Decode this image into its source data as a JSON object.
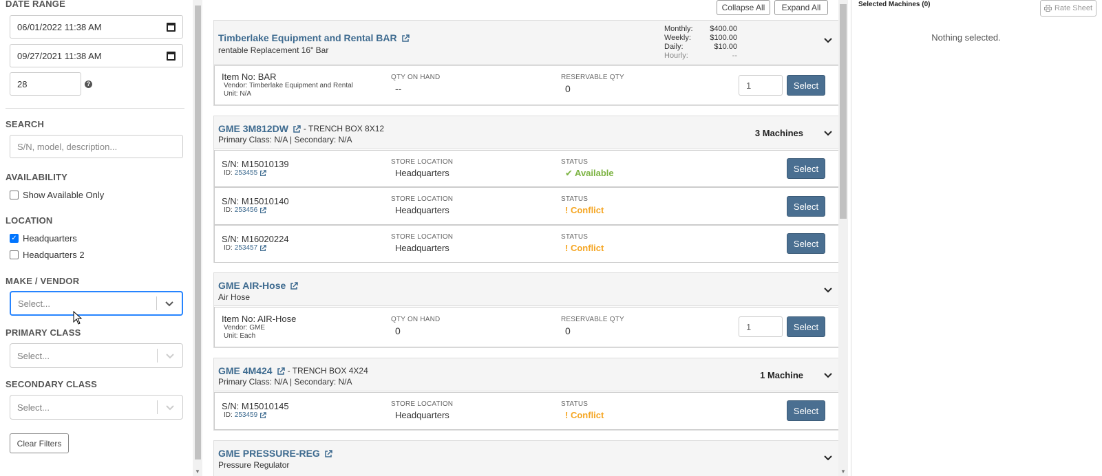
{
  "filters": {
    "date_range_title": "DATE RANGE",
    "start_date": "06/01/2022 11:38  AM",
    "end_date": "09/27/2021 11:38  AM",
    "days": "28",
    "help_glyph": "?",
    "search_title": "SEARCH",
    "search_placeholder": "S/N, model, description...",
    "availability_title": "AVAILABILITY",
    "show_available_label": "Show Available Only",
    "location_title": "LOCATION",
    "locations": [
      {
        "label": "Headquarters",
        "checked": true
      },
      {
        "label": "Headquarters 2",
        "checked": false
      }
    ],
    "make_vendor_title": "MAKE / VENDOR",
    "make_vendor_placeholder": "Select...",
    "primary_class_title": "PRIMARY CLASS",
    "primary_class_placeholder": "Select...",
    "secondary_class_title": "SECONDARY CLASS",
    "secondary_class_placeholder": "Select...",
    "clear_filters_label": "Clear Filters"
  },
  "toolbar": {
    "collapse_all": "Collapse All",
    "expand_all": "Expand All"
  },
  "cards": [
    {
      "title": "Timberlake Equipment and Rental BAR",
      "subtitle": "rentable Replacement 16\" Bar",
      "rates": [
        {
          "label": "Monthly:",
          "value": "$400.00"
        },
        {
          "label": "Weekly:",
          "value": "$100.00"
        },
        {
          "label": "Daily:",
          "value": "$10.00"
        },
        {
          "label": "Hourly:",
          "value": "--"
        }
      ],
      "row": {
        "item_no": "Item No: BAR",
        "vendor": "Vendor: Timberlake Equipment and Rental",
        "unit": "Unit: N/A",
        "qty_on_hand_label": "QTY ON HAND",
        "qty_on_hand": "--",
        "reservable_label": "RESERVABLE QTY",
        "reservable": "0",
        "qty_input": "1",
        "select_label": "Select"
      }
    },
    {
      "title": "GME 3M812DW",
      "title_suffix": "- TRENCH BOX 8X12",
      "subtitle": "Primary Class: N/A | Secondary: N/A",
      "count": "3 Machines",
      "rows": [
        {
          "sn": "S/N: M15010139",
          "id_label": "ID:",
          "id": "253455",
          "loc_label": "STORE LOCATION",
          "loc": "Headquarters",
          "status_label": "STATUS",
          "status": "Available",
          "status_glyph": "✔",
          "select_label": "Select"
        },
        {
          "sn": "S/N: M15010140",
          "id_label": "ID:",
          "id": "253456",
          "loc_label": "STORE LOCATION",
          "loc": "Headquarters",
          "status_label": "STATUS",
          "status": "Conflict",
          "status_glyph": "!",
          "select_label": "Select"
        },
        {
          "sn": "S/N: M16020224",
          "id_label": "ID:",
          "id": "253457",
          "loc_label": "STORE LOCATION",
          "loc": "Headquarters",
          "status_label": "STATUS",
          "status": "Conflict",
          "status_glyph": "!",
          "select_label": "Select"
        }
      ]
    },
    {
      "title": "GME AIR-Hose",
      "subtitle": "Air Hose",
      "row": {
        "item_no": "Item No: AIR-Hose",
        "vendor": "Vendor: GME",
        "unit": "Unit: Each",
        "qty_on_hand_label": "QTY ON HAND",
        "qty_on_hand": "0",
        "reservable_label": "RESERVABLE QTY",
        "reservable": "0",
        "qty_input": "1",
        "select_label": "Select"
      }
    },
    {
      "title": "GME 4M424",
      "title_suffix": "- TRENCH BOX 4X24",
      "subtitle": "Primary Class: N/A | Secondary: N/A",
      "count": "1 Machine",
      "rows": [
        {
          "sn": "S/N: M15010145",
          "id_label": "ID:",
          "id": "253459",
          "loc_label": "STORE LOCATION",
          "loc": "Headquarters",
          "status_label": "STATUS",
          "status": "Conflict",
          "status_glyph": "!",
          "select_label": "Select"
        }
      ]
    },
    {
      "title": "GME PRESSURE-REG",
      "subtitle": "Pressure Regulator"
    }
  ],
  "chevron_glyph": "⌄",
  "selected_panel": {
    "title": "Selected Machines (0)",
    "rate_sheet": "Rate Sheet",
    "empty": "Nothing selected."
  },
  "colors": {
    "accent": "#4a6f91",
    "link": "#3d6a8f",
    "available": "#7cb342",
    "conflict": "#f5a623"
  }
}
